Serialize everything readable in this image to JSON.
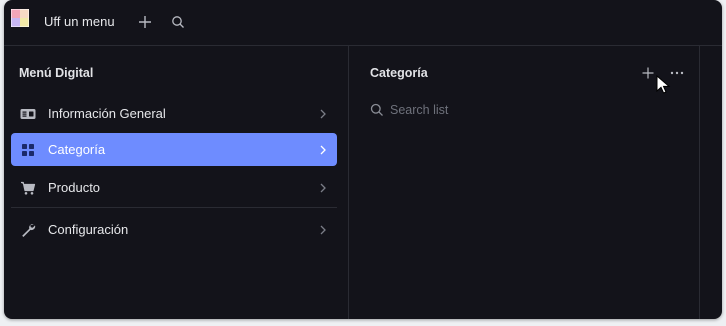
{
  "app": {
    "title": "Uff un menu"
  },
  "topbar": {
    "logo_icon": "app-logo-icon",
    "add_icon": "plus-icon",
    "search_icon": "search-icon"
  },
  "left_pane": {
    "title": "Menú Digital",
    "items": [
      {
        "label": "Información General",
        "icon": "info-card-icon",
        "active": false
      },
      {
        "label": "Categoría",
        "icon": "grid-icon",
        "active": true
      },
      {
        "label": "Producto",
        "icon": "cart-icon",
        "active": false
      },
      {
        "label": "Configuración",
        "icon": "wrench-icon",
        "active": false
      }
    ]
  },
  "middle_pane": {
    "title": "Categoría",
    "search_placeholder": "Search list",
    "add_icon": "plus-icon",
    "more_icon": "more-horizontal-icon"
  },
  "colors": {
    "background": "#13131a",
    "accent": "#6e8cff",
    "text": "#e6e7ea",
    "muted": "#6e717b",
    "border": "#2a2b33"
  }
}
